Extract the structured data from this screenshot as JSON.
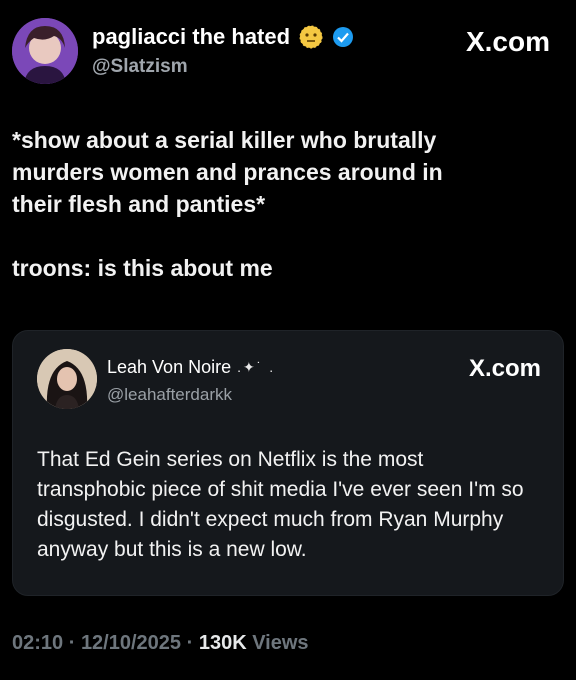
{
  "author": {
    "name": "pagliacci the hated",
    "handle": "@Slatzism",
    "emoji_icon": "dotted-face-icon",
    "verified": true
  },
  "brand_label": "X.com",
  "tweet": {
    "line1": "*show about a serial killer who brutally",
    "line2": "murders women and prances around in",
    "line3": "their flesh and panties*",
    "line4": "troons: is this about me"
  },
  "quoted": {
    "name": "Leah Von Noire",
    "sparkles": ".✦˙ .",
    "handle": "@leahafterdarkk",
    "brand_label": "X.com",
    "line1": "That Ed Gein series on Netflix is the most",
    "line2": "transphobic piece of shit media I've ever seen I'm so",
    "line3": "disgusted. I didn't expect much from Ryan Murphy",
    "line4": "anyway but this is a new low."
  },
  "meta": {
    "time": "02:10",
    "sep1": " · ",
    "date": "12/10/2025",
    "sep2": " · ",
    "views_count": "130K",
    "views_label": " Views"
  },
  "colors": {
    "background": "#000000",
    "quote_card": "#15181c",
    "muted_text": "#6e767d",
    "verified_blue": "#1d9bf0"
  }
}
